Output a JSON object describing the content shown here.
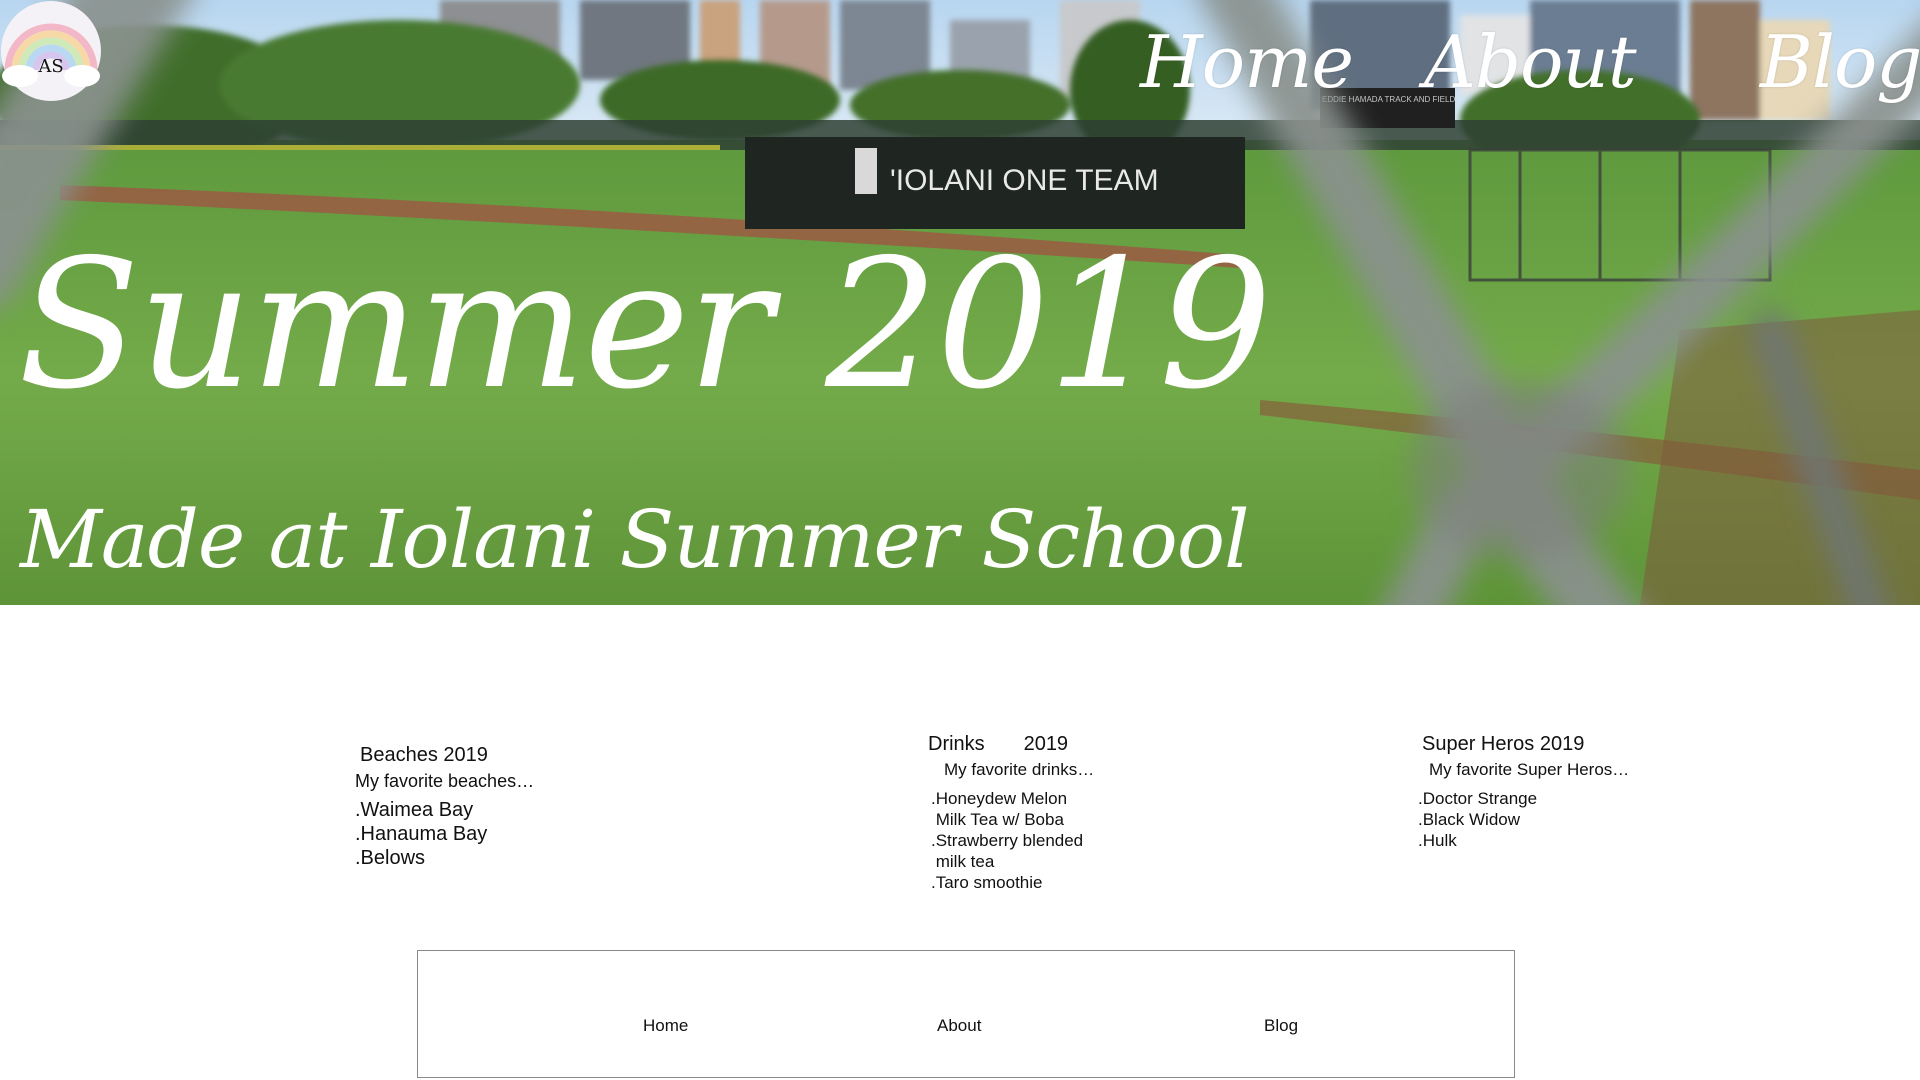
{
  "logo": {
    "text": "AS"
  },
  "nav": {
    "home": "Home",
    "about": "About",
    "blog": "Blog"
  },
  "hero": {
    "title": "Summer 2019",
    "subtitle": "Made at Iolani Summer School",
    "sign_text": "'IOLANI ONE TEAM",
    "small_sign_text": "EDDIE HAMADA TRACK AND FIELD"
  },
  "columns": {
    "beaches": {
      "heading": "Beaches 2019",
      "intro": "My favorite beaches…",
      "items": [
        ".Waimea Bay",
        ".Hanauma Bay",
        ".Belows"
      ]
    },
    "drinks": {
      "heading": "Drinks       2019",
      "intro": "My favorite drinks…",
      "items": [
        ".Honeydew Melon",
        " Milk Tea w/ Boba",
        ".Strawberry blended",
        " milk tea",
        ".Taro smoothie"
      ]
    },
    "heroes": {
      "heading": "Super Heros 2019",
      "intro": "My favorite Super Heros…",
      "items": [
        ".Doctor Strange",
        ".Black Widow",
        ".Hulk"
      ]
    }
  },
  "footer": {
    "home": "Home",
    "about": "About",
    "blog": "Blog"
  },
  "colors": {
    "sky": "#cfe3f4",
    "grass": "#6fa24a",
    "dirt": "#9b5a43",
    "fence": "#7f8a88",
    "text_light": "#ffffff",
    "text_dark": "#111111"
  }
}
